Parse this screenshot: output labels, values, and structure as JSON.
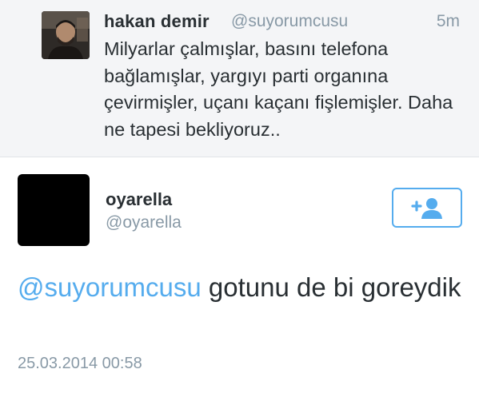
{
  "colors": {
    "link": "#55acee",
    "text": "#292f33",
    "muted": "#8899a6",
    "parent_background": "#f4f5f7"
  },
  "parent_tweet": {
    "avatar_icon": "user-photo",
    "name": "hakan demir",
    "handle": "@suyorumcusu",
    "time": "5m",
    "text": "Milyarlar çalmışlar, basını telefona bağlamışlar, yargıyı parti organına çevirmişler, uçanı kaçanı fişlemişler. Daha ne tapesi bekliyoruz.."
  },
  "reply_tweet": {
    "avatar_icon": "black-avatar",
    "name": "oyarella",
    "handle": "@oyarella",
    "follow_icon": "add-user-icon",
    "mention": "@suyorumcusu",
    "text": " gotunu de bi goreydik",
    "timestamp": "25.03.2014 00:58"
  }
}
